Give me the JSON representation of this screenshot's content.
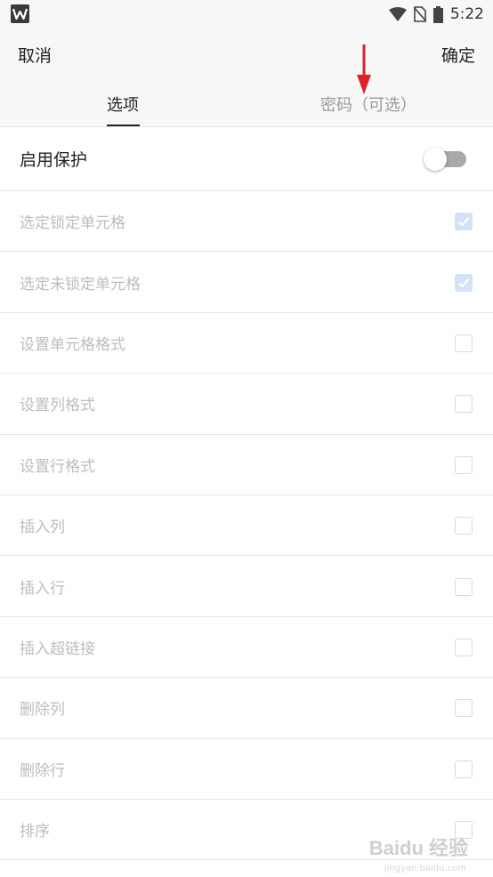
{
  "status_bar": {
    "time": "5:22",
    "icons": [
      "wps-logo-icon",
      "wifi-icon",
      "no-sim-icon",
      "battery-icon"
    ]
  },
  "header": {
    "cancel_label": "取消",
    "confirm_label": "确定",
    "tabs": [
      {
        "label": "选项",
        "active": true
      },
      {
        "label": "密码（可选）",
        "active": false
      }
    ]
  },
  "protection": {
    "label": "启用保护",
    "enabled": false
  },
  "options": [
    {
      "label": "选定锁定单元格",
      "checked": true
    },
    {
      "label": "选定未锁定单元格",
      "checked": true
    },
    {
      "label": "设置单元格格式",
      "checked": false
    },
    {
      "label": "设置列格式",
      "checked": false
    },
    {
      "label": "设置行格式",
      "checked": false
    },
    {
      "label": "插入列",
      "checked": false
    },
    {
      "label": "插入行",
      "checked": false
    },
    {
      "label": "插入超链接",
      "checked": false
    },
    {
      "label": "删除列",
      "checked": false
    },
    {
      "label": "删除行",
      "checked": false
    },
    {
      "label": "排序",
      "checked": false
    }
  ],
  "watermark": {
    "brand": "Baidu 经验",
    "url": "jingyan.baidu.com"
  },
  "colors": {
    "arrow": "#e0202a",
    "checked_fill": "#d4e2f8",
    "disabled_text": "#bdbdbd"
  }
}
